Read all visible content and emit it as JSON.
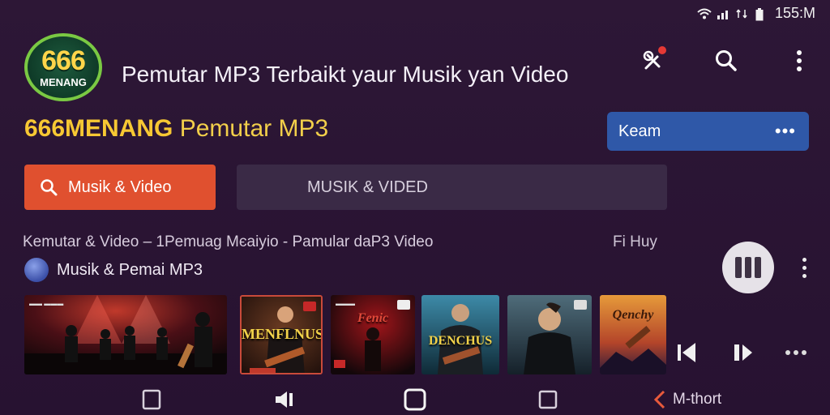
{
  "status": {
    "time": "155:Μ"
  },
  "logo": {
    "number": "666",
    "text": "MENANG"
  },
  "header": {
    "title": "Pemutar MP3 Terbaikt yaur Musik yan Video"
  },
  "brand": {
    "strong": "666MENANG",
    "light": "Pemutar MP3"
  },
  "keam_button": {
    "label": "Keam",
    "more": "•••"
  },
  "tabs": {
    "primary": "Musik & Video",
    "secondary": "MUSIK & VIDED"
  },
  "breadcrumb": "Kemutar & Video – 1Pemuag Mєaiyio - Pamular daP3 Video",
  "filter_label": "Fi Huy",
  "playlist": {
    "label": "Musik & Pemai MP3"
  },
  "thumbnails": [
    {
      "title": ""
    },
    {
      "title": "MENFLNUS"
    },
    {
      "title": "Fenic"
    },
    {
      "title": "DENCHUS"
    },
    {
      "title": ""
    },
    {
      "title": "Qenchy"
    }
  ],
  "nav": {
    "back_label": "M-thort"
  },
  "colors": {
    "background": "#2a1533",
    "accent_orange": "#e0502f",
    "accent_blue": "#2f58a8",
    "brand_yellow": "#f7c833"
  }
}
